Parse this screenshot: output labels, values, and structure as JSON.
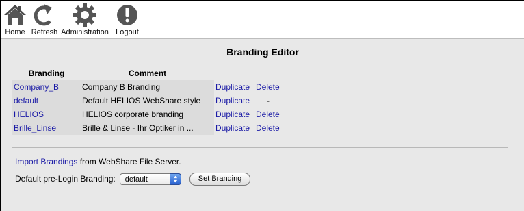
{
  "toolbar": {
    "items": [
      {
        "label": "Home",
        "icon": "home-icon"
      },
      {
        "label": "Refresh",
        "icon": "refresh-icon"
      },
      {
        "label": "Administration",
        "icon": "gear-icon"
      },
      {
        "label": "Logout",
        "icon": "logout-icon"
      }
    ]
  },
  "editor": {
    "title": "Branding Editor",
    "columns": {
      "branding": "Branding",
      "comment": "Comment"
    },
    "rows": [
      {
        "name": "Company_B",
        "comment": "Company B Branding",
        "duplicate": "Duplicate",
        "delete": "Delete"
      },
      {
        "name": "default",
        "comment": "Default HELIOS WebShare style",
        "duplicate": "Duplicate",
        "delete": "-"
      },
      {
        "name": "HELIOS",
        "comment": "HELIOS corporate branding",
        "duplicate": "Duplicate",
        "delete": "Delete"
      },
      {
        "name": "Brille_Linse",
        "comment": "Brille & Linse - Ihr Optiker in ...",
        "duplicate": "Duplicate",
        "delete": "Delete"
      }
    ]
  },
  "import": {
    "link_label": "Import Brandings",
    "suffix": " from WebShare File Server."
  },
  "default_branding": {
    "label": "Default pre-Login Branding:",
    "selected": "default",
    "button_label": "Set Branding"
  },
  "colors": {
    "link": "#1a1aa6",
    "page_bg": "#e8e8e8",
    "toolbar_bg": "#ffffff",
    "row_bg": "#dcdcdc",
    "select_arrow": "#2a62d0"
  }
}
